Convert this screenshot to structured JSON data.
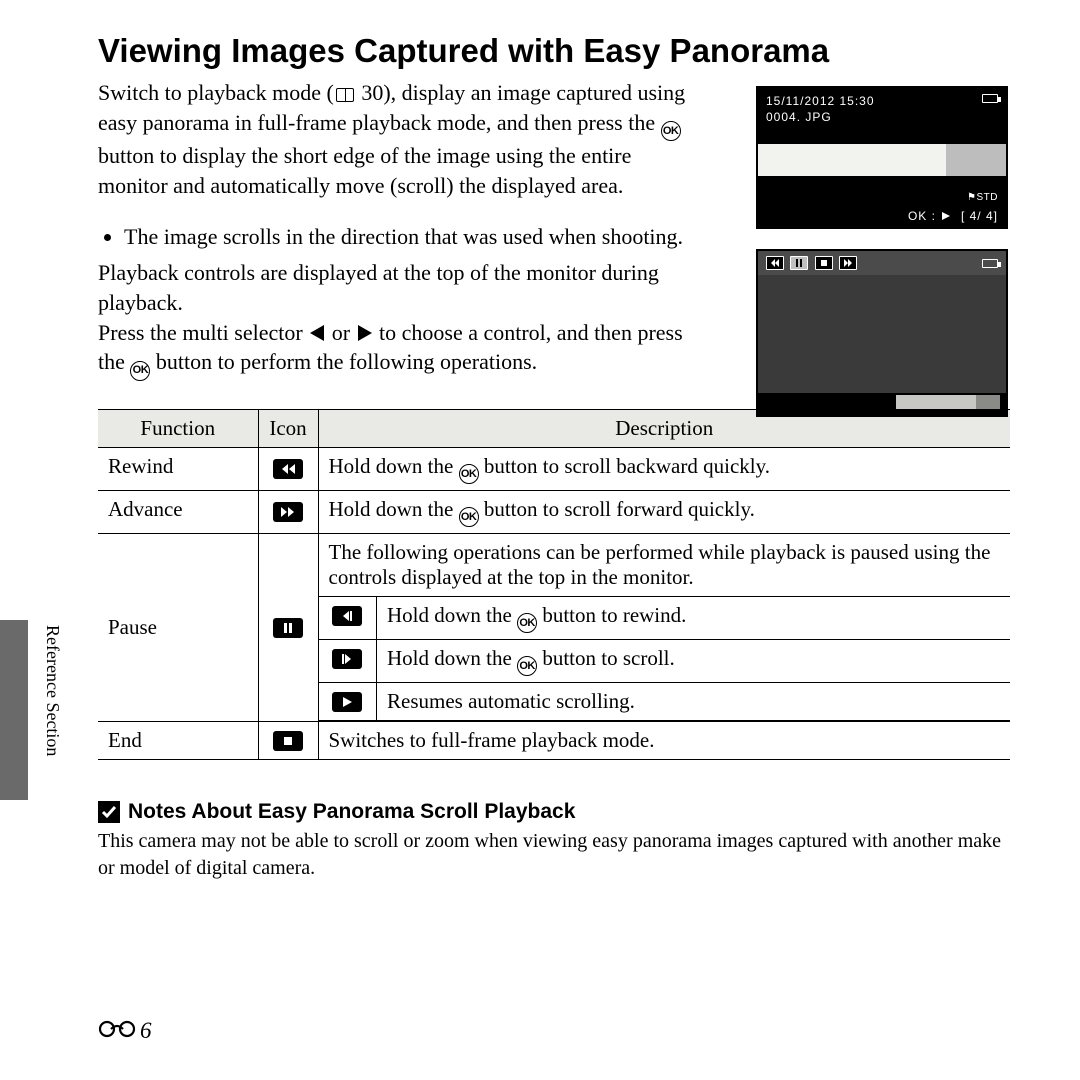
{
  "side_label": "Reference Section",
  "heading": "Viewing Images Captured with Easy Panorama",
  "intro": {
    "p1a": "Switch to playback mode (",
    "p1b": " 30), display an image captured using easy panorama in full-frame playback mode, and then press the ",
    "p1c": " button to display the short edge of the image using the entire monitor and automatically move (scroll) the displayed area.",
    "pref": "30"
  },
  "mid": {
    "bullet": "The image scrolls in the direction that was used when shooting.",
    "p2": "Playback controls are displayed at the top of the monitor during playback.",
    "p3a": "Press the multi selector ",
    "p3b": " or ",
    "p3c": " to choose a control, and then press the ",
    "p3d": " button to perform the following operations."
  },
  "screen1": {
    "datetime": "15/11/2012 15:30",
    "filename": "0004. JPG",
    "badge": "STD",
    "okline": "OK :",
    "counter": "[   4/    4]"
  },
  "table": {
    "headers": {
      "func": "Function",
      "icon": "Icon",
      "desc": "Description"
    },
    "rows": {
      "rewind": {
        "f": "Rewind",
        "d1": "Hold down the ",
        "d2": " button to scroll backward quickly."
      },
      "advance": {
        "f": "Advance",
        "d1": "Hold down the ",
        "d2": " button to scroll forward quickly."
      },
      "pause": {
        "f": "Pause",
        "intro": "The following operations can be performed while playback is paused using the controls displayed at the top in the monitor.",
        "s1a": "Hold down the ",
        "s1b": " button to rewind.",
        "s2a": "Hold down the ",
        "s2b": " button to scroll.",
        "s3": "Resumes automatic scrolling."
      },
      "end": {
        "f": "End",
        "d": "Switches to full-frame playback mode."
      }
    }
  },
  "notes": {
    "title": "Notes About Easy Panorama Scroll Playback",
    "body": "This camera may not be able to scroll or zoom when viewing easy panorama images captured with another make or model of digital camera."
  },
  "page_number": "6"
}
